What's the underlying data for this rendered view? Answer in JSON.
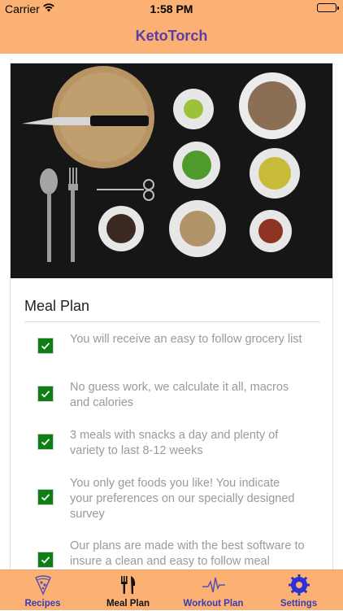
{
  "status_bar": {
    "carrier": "Carrier",
    "time": "1:58 PM"
  },
  "nav": {
    "title": "KetoTorch"
  },
  "card": {
    "title": "Meal Plan",
    "items": [
      {
        "text": "You will receive an easy to follow grocery list"
      },
      {
        "text": "No guess work, we calculate it all, macros and calories"
      },
      {
        "text": "3 meals with snacks a day and plenty of variety to last 8-12 weeks"
      },
      {
        "text": "You only get foods you like! You indicate your preferences on our specially designed survey"
      },
      {
        "text": "Our plans are made with the best software to insure a clean and easy to follow meal"
      }
    ]
  },
  "tabs": [
    {
      "label": "Recipes",
      "icon": "pizza-slice-icon"
    },
    {
      "label": "Meal Plan",
      "icon": "fork-knife-icon",
      "active": true
    },
    {
      "label": "Workout Plan",
      "icon": "heartbeat-icon"
    },
    {
      "label": "Settings",
      "icon": "gear-icon"
    }
  ],
  "colors": {
    "bar": "#FBB173",
    "title": "#5A3EA6",
    "check": "#0d7f14",
    "tab_label": "#3b3bb5"
  }
}
